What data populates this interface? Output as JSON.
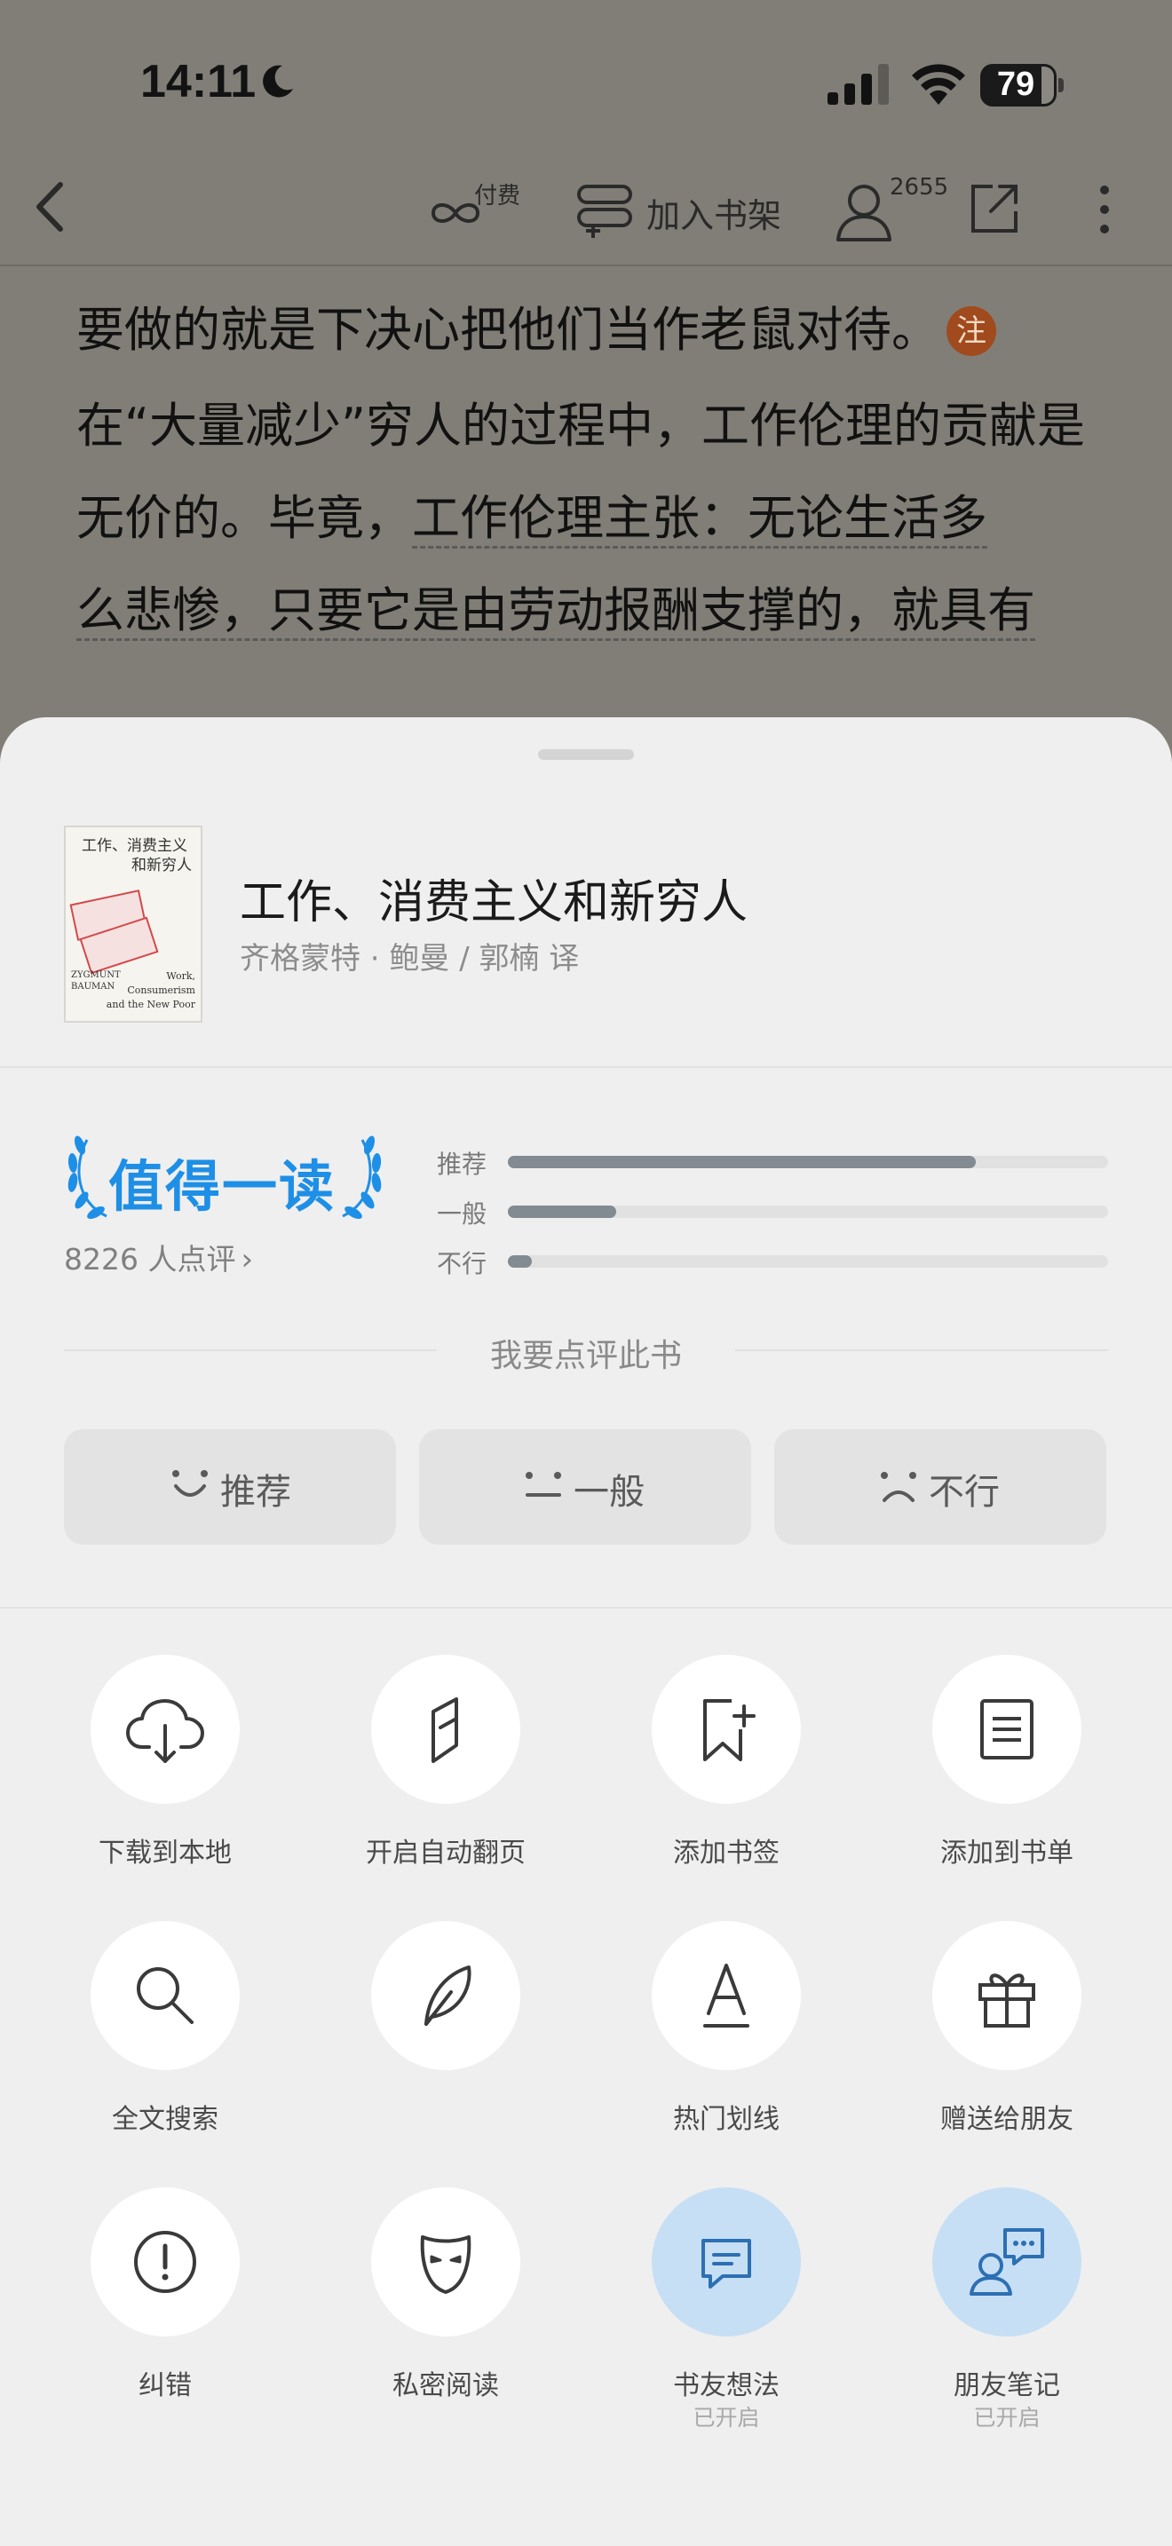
{
  "status_bar": {
    "time": "14:11",
    "battery": "79"
  },
  "topbar": {
    "paid_label": "付费",
    "add_shelf_label": "加入书架",
    "reader_count": "2655"
  },
  "reading": {
    "line1": "要做的就是下决心把他们当作老鼠对待。",
    "note_badge": "注",
    "para2_plain": "在“大量减少”穷人的过程中，工作伦理的贡献是无价的。毕竟，",
    "para2_underlined_a": "工作伦理主张：无论生活多",
    "para2_underlined_b": "么悲惨，只要它是由劳动报酬支撑的，就具有"
  },
  "book": {
    "title": "工作、消费主义和新穷人",
    "author": "齐格蒙特 · 鲍曼 / 郭楠 译",
    "cover": {
      "title_lines": [
        "工作、消费主义",
        "和新穷人"
      ],
      "author_en": [
        "ZYGMUNT",
        "BAUMAN"
      ],
      "title_en": [
        "Work,",
        "Consumerism",
        "and the New Poor"
      ]
    }
  },
  "rating": {
    "badge": "值得一读",
    "count_text": "8226 人点评",
    "chevron": "›",
    "bars": [
      {
        "label": "推荐",
        "fraction": 0.78
      },
      {
        "label": "一般",
        "fraction": 0.18
      },
      {
        "label": "不行",
        "fraction": 0.04
      }
    ],
    "prompt": "我要点评此书",
    "buttons": [
      {
        "label": "推荐",
        "icon": "smile-icon"
      },
      {
        "label": "一般",
        "icon": "neutral-face-icon"
      },
      {
        "label": "不行",
        "icon": "frown-icon"
      }
    ]
  },
  "tools": [
    {
      "label": "下载到本地",
      "sub": "",
      "icon": "cloud-download-icon"
    },
    {
      "label": "开启自动翻页",
      "sub": "",
      "icon": "auto-page-icon"
    },
    {
      "label": "添加书签",
      "sub": "",
      "icon": "bookmark-add-icon"
    },
    {
      "label": "添加到书单",
      "sub": "",
      "icon": "booklist-icon"
    },
    {
      "label": "全文搜索",
      "sub": "",
      "icon": "search-icon"
    },
    {
      "label": "",
      "sub": "",
      "icon": "feather-icon"
    },
    {
      "label": "热门划线",
      "sub": "",
      "icon": "underline-a-icon"
    },
    {
      "label": "赠送给朋友",
      "sub": "",
      "icon": "gift-icon"
    },
    {
      "label": "纠错",
      "sub": "",
      "icon": "alert-circle-icon"
    },
    {
      "label": "私密阅读",
      "sub": "",
      "icon": "mask-icon"
    },
    {
      "label": "书友想法",
      "sub": "已开启",
      "icon": "comment-icon"
    },
    {
      "label": "朋友笔记",
      "sub": "已开启",
      "icon": "friends-notes-icon"
    }
  ],
  "colors": {
    "accent_blue": "#1e8fe6",
    "active_circle": "#c6dff5",
    "bar_fill": "#828a92"
  }
}
